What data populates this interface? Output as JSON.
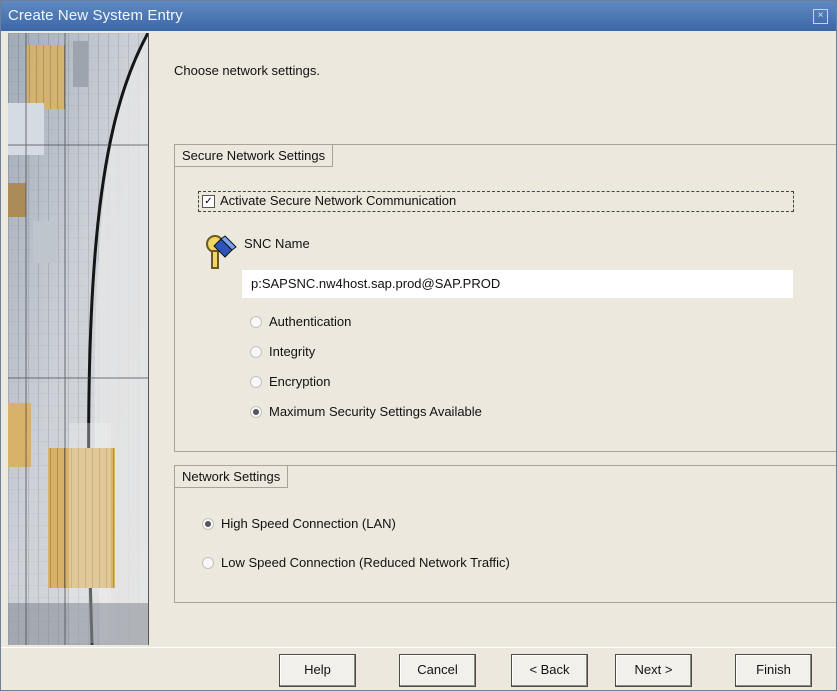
{
  "window": {
    "title": "Create New System Entry"
  },
  "instruction": "Choose network settings.",
  "secure_group": {
    "title": "Secure Network Settings",
    "checkbox_label": "Activate Secure Network Communication",
    "checked": true,
    "snc_label": "SNC Name",
    "snc_value": "p:SAPSNC.nw4host.sap.prod@SAP.PROD",
    "options": [
      "Authentication",
      "Integrity",
      "Encryption",
      "Maximum Security Settings Available"
    ],
    "selected": "Maximum Security Settings Available"
  },
  "network_group": {
    "title": "Network Settings",
    "options": [
      "High Speed Connection (LAN)",
      "Low Speed Connection (Reduced Network Traffic)"
    ],
    "selected": "High Speed Connection (LAN)"
  },
  "buttons": {
    "help": "Help",
    "cancel": "Cancel",
    "back": "< Back",
    "next": "Next >",
    "finish": "Finish"
  },
  "icons": {
    "close": "close-icon",
    "snc": "key-lock-icon"
  },
  "colors": {
    "title_bar": "#3b67a6",
    "dialog_background": "#ece8de"
  }
}
